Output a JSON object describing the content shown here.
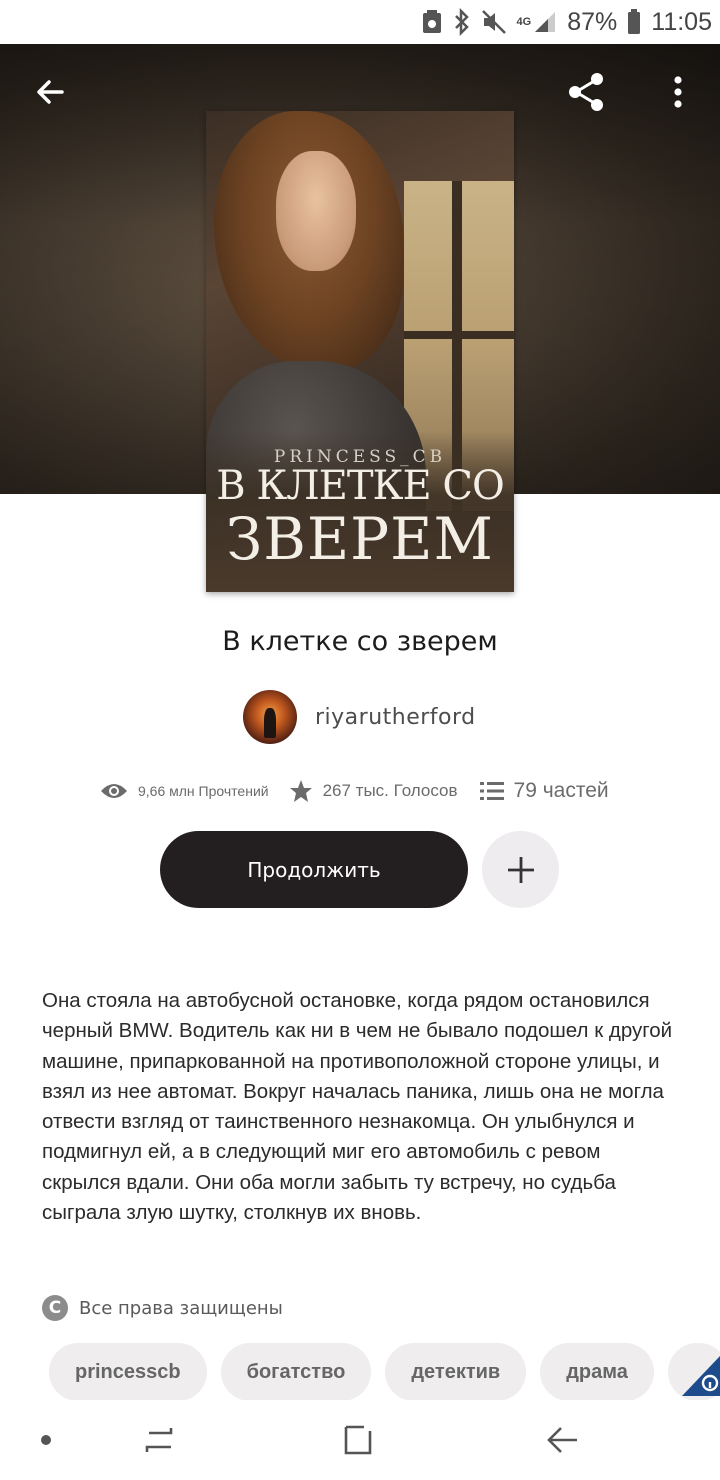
{
  "status_bar": {
    "network": "4G",
    "battery": "87%",
    "time": "11:05"
  },
  "header": {
    "back_icon": "arrow-left-icon",
    "share_icon": "share-icon",
    "more_icon": "more-vertical-icon"
  },
  "cover": {
    "author_line": "PRINCESS_CB",
    "title_line1": "В КЛЕТКЕ СО",
    "title_line2": "ЗВЕРЕМ"
  },
  "book": {
    "title": "В клетке со зверем",
    "author": "riyarutherford"
  },
  "stats": {
    "reads": "9,66 млн Прочтений",
    "votes": "267 тыс. Голосов",
    "parts": "79 частей"
  },
  "actions": {
    "continue_label": "Продолжить",
    "add_icon": "plus-icon"
  },
  "description": "Она стояла на автобусной остановке, когда рядом остановился черный BMW. Водитель как ни в чем не бывало подошел к другой машине, припаркованной на противоположной стороне улицы, и взял из нее автомат. Вокруг началась паника, лишь она не могла отвести взгляд от таинственного незнакомца. Он улыбнулся и подмигнул ей, а в следующий миг его автомобиль с ревом скрылся вдали. Они оба могли забыть ту встречу, но судьба сыграла злую шутку, столкнув их вновь.",
  "copyright": {
    "symbol": "C",
    "text": "Все права защищены"
  },
  "tags": [
    "princesscb",
    "богатство",
    "детектив",
    "драма"
  ],
  "colors": {
    "primary_button": "#231f20",
    "tag_bg": "#efeded",
    "badge_blue": "#1e4b8c"
  }
}
